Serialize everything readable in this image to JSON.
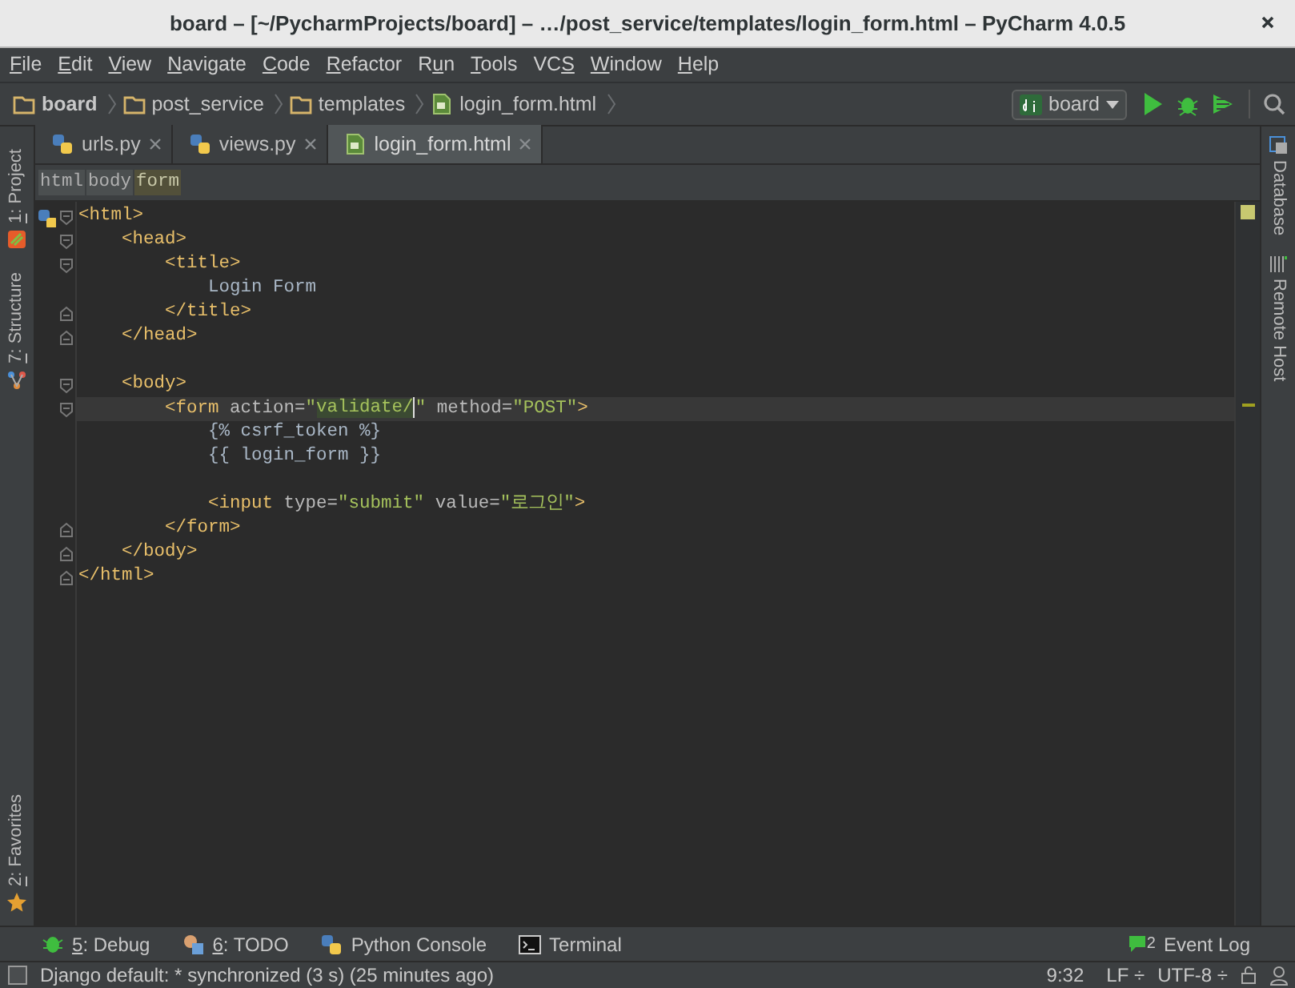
{
  "window": {
    "title": "board – [~/PycharmProjects/board] – …/post_service/templates/login_form.html – PyCharm 4.0.5"
  },
  "menu": [
    {
      "key": "F",
      "after": "ile"
    },
    {
      "key": "E",
      "after": "dit"
    },
    {
      "key": "V",
      "after": "iew"
    },
    {
      "key": "N",
      "after": "avigate"
    },
    {
      "key": "C",
      "after": "ode"
    },
    {
      "key": "R",
      "after": "efactor"
    },
    {
      "before": "R",
      "key": "u",
      "after": "n"
    },
    {
      "key": "T",
      "after": "ools"
    },
    {
      "before": "VC",
      "key": "S"
    },
    {
      "key": "W",
      "after": "indow"
    },
    {
      "key": "H",
      "after": "elp"
    }
  ],
  "navigation": {
    "path": [
      {
        "label": "board",
        "kind": "folder",
        "bold": true
      },
      {
        "label": "post_service",
        "kind": "folder",
        "bold": false
      },
      {
        "label": "templates",
        "kind": "folder",
        "bold": false
      },
      {
        "label": "login_form.html",
        "kind": "file",
        "bold": false
      }
    ],
    "run_config": "board"
  },
  "left_tool_windows": [
    {
      "key": "1",
      "after": ": Project",
      "kind": "project"
    },
    {
      "key": "7",
      "after": ": Structure",
      "kind": "structure"
    }
  ],
  "left_bottom_tool_windows": [
    {
      "key": "2",
      "after": ": Favorites",
      "kind": "favorites"
    }
  ],
  "right_tool_windows": [
    {
      "label": "Database",
      "kind": "database"
    },
    {
      "label": "Remote Host",
      "kind": "host"
    }
  ],
  "tabs": [
    {
      "label": "urls.py",
      "kind": "python",
      "selected": false
    },
    {
      "label": "views.py",
      "kind": "python",
      "selected": false
    },
    {
      "label": "login_form.html",
      "kind": "html",
      "selected": true
    }
  ],
  "tag_path": [
    {
      "label": "html",
      "selected": false
    },
    {
      "label": "body",
      "selected": false
    },
    {
      "label": "form",
      "selected": true
    }
  ],
  "editor": {
    "lines": [
      {
        "kind": "open",
        "tokens": [
          {
            "kind": "tag",
            "text": "<html>"
          }
        ]
      },
      {
        "kind": "open",
        "tokens": [
          {
            "kind": "tag",
            "text": "    <head>"
          }
        ]
      },
      {
        "kind": "open",
        "tokens": [
          {
            "kind": "tag",
            "text": "        <title>"
          }
        ]
      },
      {
        "kind": "plain",
        "tokens": [
          {
            "kind": "text",
            "text": "            Login Form"
          }
        ]
      },
      {
        "kind": "close",
        "tokens": [
          {
            "kind": "tag",
            "text": "        </title>"
          }
        ]
      },
      {
        "kind": "close",
        "tokens": [
          {
            "kind": "tag",
            "text": "    </head>"
          }
        ]
      },
      {
        "kind": "plain"
      },
      {
        "kind": "open",
        "tokens": [
          {
            "kind": "tag",
            "text": "    <body>"
          }
        ]
      },
      {
        "kind": "open",
        "current": true,
        "tokens": [
          {
            "kind": "tag",
            "text": "        <form "
          },
          {
            "kind": "attr",
            "text": "action="
          },
          {
            "kind": "value",
            "text": "\"",
            "highlighted": false
          },
          {
            "kind": "value",
            "text": "validate/",
            "highlighted": true,
            "caret_after": true
          },
          {
            "kind": "value",
            "text": "\"",
            "highlighted": false
          },
          {
            "kind": "attr",
            "text": " method="
          },
          {
            "kind": "value",
            "text": "\"POST\"",
            "highlighted": false
          },
          {
            "kind": "tag",
            "text": ">"
          }
        ]
      },
      {
        "kind": "plain",
        "tokens": [
          {
            "kind": "text",
            "text": "            {% csrf_token %}"
          }
        ]
      },
      {
        "kind": "plain",
        "tokens": [
          {
            "kind": "text",
            "text": "            {{ login_form }}"
          }
        ]
      },
      {
        "kind": "plain"
      },
      {
        "kind": "plain",
        "tokens": [
          {
            "kind": "tag",
            "text": "            <input "
          },
          {
            "kind": "attr",
            "text": "type="
          },
          {
            "kind": "value",
            "text": "\"submit\"",
            "highlighted": false
          },
          {
            "kind": "attr",
            "text": " value="
          },
          {
            "kind": "value",
            "text": "\"로그인\"",
            "highlighted": false
          },
          {
            "kind": "tag",
            "text": ">"
          }
        ]
      },
      {
        "kind": "close",
        "tokens": [
          {
            "kind": "tag",
            "text": "        </form>"
          }
        ]
      },
      {
        "kind": "close",
        "tokens": [
          {
            "kind": "tag",
            "text": "    </body>"
          }
        ]
      },
      {
        "kind": "close",
        "tokens": [
          {
            "kind": "tag",
            "text": "</html>"
          }
        ]
      }
    ]
  },
  "bottom_tool_windows": [
    {
      "key": "5",
      "after": ": Debug",
      "kind": "debug"
    },
    {
      "key": "6",
      "after": ": TODO",
      "kind": "todo"
    },
    {
      "after": "Python Console",
      "kind": "console"
    },
    {
      "after": "Terminal",
      "kind": "terminal"
    }
  ],
  "event_log": {
    "count": "2",
    "label": "Event Log"
  },
  "status_bar": {
    "message": "Django default: * synchronized (3 s) (25 minutes ago)",
    "position": "9:32",
    "line_separator": "LF ÷",
    "encoding": "UTF-8 ÷"
  }
}
